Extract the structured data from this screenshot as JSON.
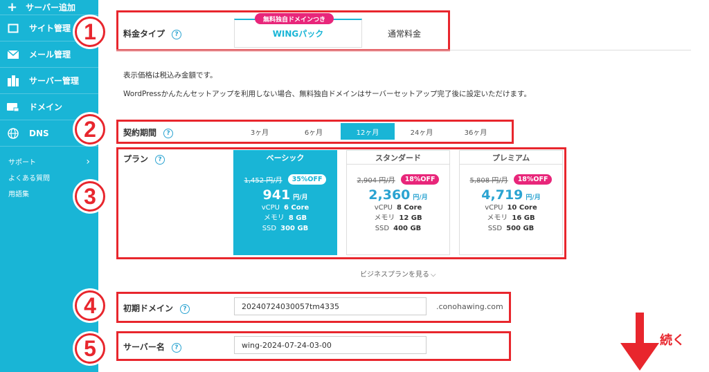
{
  "sidebar": {
    "add_server": "サーバー追加",
    "items": [
      {
        "label": "サイト管理",
        "icon": "window-icon"
      },
      {
        "label": "メール管理",
        "icon": "mail-icon"
      },
      {
        "label": "サーバー管理",
        "icon": "server-icon"
      },
      {
        "label": "ドメイン",
        "icon": "domain-icon"
      },
      {
        "label": "DNS",
        "icon": "globe-icon"
      }
    ],
    "support": "サポート",
    "support_arrow": "›",
    "faq": "よくある質問",
    "glossary": "用語集"
  },
  "steps": [
    "1",
    "2",
    "3",
    "4",
    "5"
  ],
  "help_glyph": "?",
  "pricing_type": {
    "label": "料金タイプ",
    "ribbon": "無料独自ドメインつき",
    "tabs": [
      "WINGパック",
      "通常料金"
    ],
    "active": 0
  },
  "notes": [
    "表示価格は税込み金額です。",
    "WordPressかんたんセットアップを利用しない場合、無料独自ドメインはサーバーセットアップ完了後に設定いただけます。"
  ],
  "contract": {
    "label": "契約期間",
    "periods": [
      "3ヶ月",
      "6ヶ月",
      "12ヶ月",
      "24ヶ月",
      "36ヶ月"
    ],
    "active": 2
  },
  "plan": {
    "label": "プラン",
    "plans": [
      {
        "name": "ベーシック",
        "old_price": "1,452 円/月",
        "discount": "35%OFF",
        "price": "941",
        "unit": "円/月",
        "vcpu": "6 Core",
        "memory": "8 GB",
        "ssd": "300 GB"
      },
      {
        "name": "スタンダード",
        "old_price": "2,904 円/月",
        "discount": "18%OFF",
        "price": "2,360",
        "unit": "円/月",
        "vcpu": "8 Core",
        "memory": "12 GB",
        "ssd": "400 GB"
      },
      {
        "name": "プレミアム",
        "old_price": "5,808 円/月",
        "discount": "18%OFF",
        "price": "4,719",
        "unit": "円/月",
        "vcpu": "10 Core",
        "memory": "16 GB",
        "ssd": "500 GB"
      }
    ],
    "spec_labels": {
      "vcpu": "vCPU",
      "memory": "メモリ",
      "ssd": "SSD"
    },
    "active": 0
  },
  "business_link": "ビジネスプランを見る",
  "business_chevron": "⌵",
  "initial_domain": {
    "label": "初期ドメイン",
    "value": "20240724030057tm4335",
    "suffix": ".conohawing.com"
  },
  "server_name": {
    "label": "サーバー名",
    "value": "wing-2024-07-24-03-00"
  },
  "continue_label": "続く",
  "colors": {
    "accent": "#19b5d6",
    "red": "#e8262d",
    "pink": "#e8267a"
  }
}
